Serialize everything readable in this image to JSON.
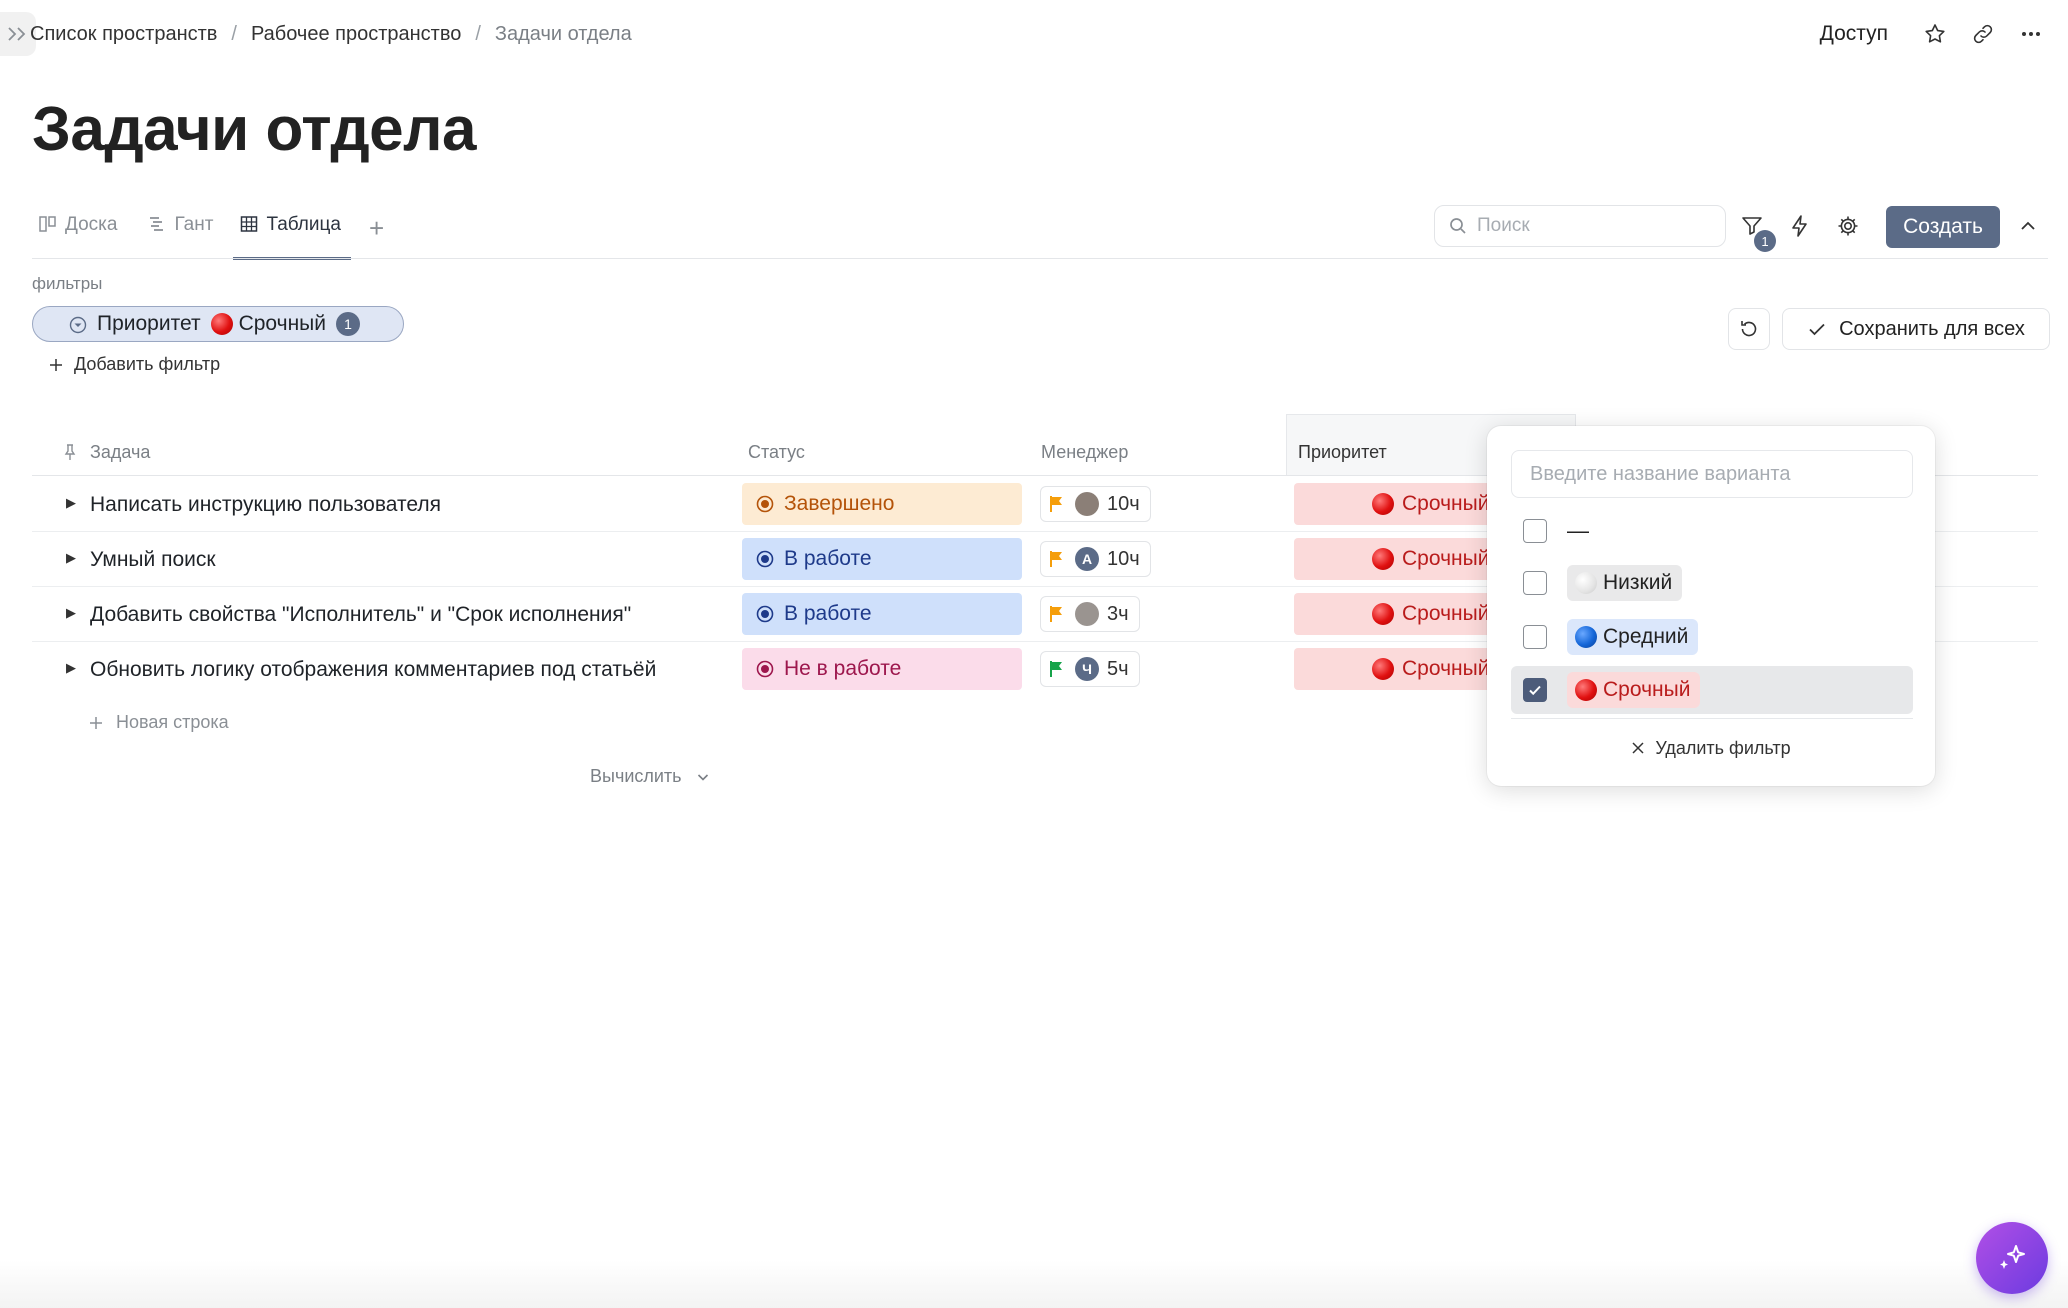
{
  "breadcrumb": {
    "items": [
      "Список пространств",
      "Рабочее пространство",
      "Задачи отдела"
    ],
    "separator": "/"
  },
  "header": {
    "access_label": "Доступ",
    "icons": [
      "star-icon",
      "link-icon",
      "more-icon"
    ]
  },
  "page": {
    "title": "Задачи отдела"
  },
  "tabs": [
    {
      "label": "Доска",
      "icon": "board-icon",
      "active": false
    },
    {
      "label": "Гант",
      "icon": "gantt-icon",
      "active": false
    },
    {
      "label": "Таблица",
      "icon": "table-icon",
      "active": true
    }
  ],
  "toolbar": {
    "search_placeholder": "Поиск",
    "filter_count": "1",
    "create_label": "Создать"
  },
  "filters": {
    "section_label": "фильтры",
    "active_filter": {
      "field": "Приоритет",
      "value": "Срочный",
      "count": "1"
    },
    "add_filter_label": "Добавить фильтр",
    "save_label": "Сохранить для всех"
  },
  "table": {
    "columns": [
      "Задача",
      "Статус",
      "Менеджер",
      "Приоритет"
    ],
    "rows": [
      {
        "task": "Написать инструкцию пользователя",
        "status": "Завершено",
        "status_color": "#fdebd3",
        "status_text_color": "#b45309",
        "flag_color": "#f59e0b",
        "avatar_letter": "",
        "avatar_color": "#8b7f77",
        "hours": "10ч",
        "priority": "Срочный"
      },
      {
        "task": "Умный поиск",
        "status": "В работе",
        "status_color": "#cfe0fb",
        "status_text_color": "#1e3a8a",
        "flag_color": "#f59e0b",
        "avatar_letter": "А",
        "avatar_color": "#5b6b87",
        "hours": "10ч",
        "priority": "Срочный"
      },
      {
        "task": "Добавить свойства \"Исполнитель\" и \"Срок исполнения\"",
        "status": "В работе",
        "status_color": "#cfe0fb",
        "status_text_color": "#1e3a8a",
        "flag_color": "#f59e0b",
        "avatar_letter": "",
        "avatar_color": "#9a9490",
        "hours": "3ч",
        "priority": "Срочный"
      },
      {
        "task": "Обновить логику отображения комментариев под статьёй",
        "status": "Не в работе",
        "status_color": "#fbdcea",
        "status_text_color": "#9d174d",
        "flag_color": "#16a34a",
        "avatar_letter": "Ч",
        "avatar_color": "#5b6b87",
        "hours": "5ч",
        "priority": "Срочный"
      }
    ],
    "new_row_label": "Новая строка",
    "calc_label": "Вычислить"
  },
  "dropdown": {
    "input_placeholder": "Введите название варианта",
    "options": [
      {
        "label": "—",
        "checked": false
      },
      {
        "label": "Низкий",
        "checked": false
      },
      {
        "label": "Средний",
        "checked": false
      },
      {
        "label": "Срочный",
        "checked": true
      }
    ],
    "remove_label": "Удалить фильтр"
  },
  "colors": {
    "accent": "#5b6b87",
    "urgent_bg": "#fbdada",
    "urgent_text": "#b91c1c"
  }
}
